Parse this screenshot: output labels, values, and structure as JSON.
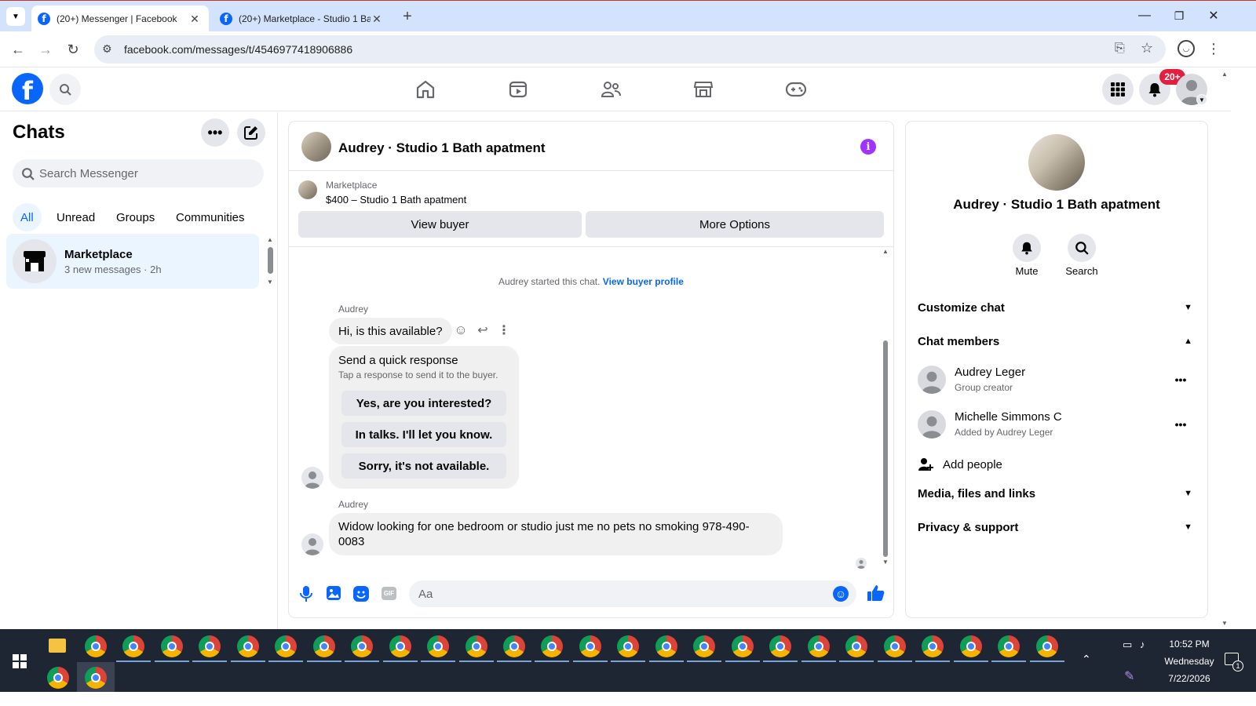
{
  "browser": {
    "tabs": [
      {
        "title": "(20+) Messenger | Facebook",
        "active": true
      },
      {
        "title": "(20+) Marketplace - Studio 1 Ba",
        "active": false
      }
    ],
    "url": "facebook.com/messages/t/4546977418906886"
  },
  "fb": {
    "notif_badge": "20+"
  },
  "left": {
    "title": "Chats",
    "search_placeholder": "Search Messenger",
    "filters": [
      "All",
      "Unread",
      "Groups",
      "Communities"
    ],
    "chat": {
      "name": "Marketplace",
      "meta": "3 new messages · 2h"
    }
  },
  "conversation": {
    "title": "Audrey · Studio 1 Bath apatment",
    "listing_label": "Marketplace",
    "listing_title": "$400 – Studio 1 Bath apatment",
    "view_buyer": "View buyer",
    "more_options": "More Options",
    "started_text": "Audrey started this chat.",
    "view_profile": "View buyer profile",
    "sender": "Audrey",
    "msg1": "Hi, is this available?",
    "quick_title": "Send a quick response",
    "quick_sub": "Tap a response to send it to the buyer.",
    "quick_options": [
      "Yes, are you interested?",
      "In talks. I'll let you know.",
      "Sorry, it's not available."
    ],
    "msg2": "Widow looking for one bedroom or studio just me no pets no smoking 978-490-0083",
    "composer_placeholder": "Aa"
  },
  "right": {
    "title": "Audrey · Studio 1 Bath apatment",
    "mute": "Mute",
    "search": "Search",
    "customize": "Customize chat",
    "members_header": "Chat members",
    "members": [
      {
        "name": "Audrey Leger",
        "role": "Group creator"
      },
      {
        "name": "Michelle Simmons C",
        "role": "Added by Audrey Leger"
      }
    ],
    "add_people": "Add people",
    "media": "Media, files and links",
    "privacy": "Privacy & support"
  },
  "taskbar": {
    "time": "10:52 PM",
    "day": "Wednesday",
    "date": "7/22/2026",
    "notif_count": "1"
  },
  "colors": {
    "fb_blue": "#0866ff",
    "accent_purple": "#a033ff",
    "taskbar": "#1f2633"
  }
}
